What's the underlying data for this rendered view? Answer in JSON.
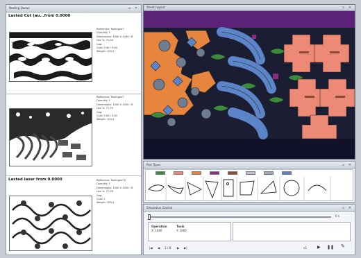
{
  "left_panel": {
    "title": "Nesting Queue",
    "sheets": [
      {
        "header": "Lasted Cut (au...from 0.0000",
        "lines": [
          "Reference: Toolingno7",
          "Quantity: 1",
          "Dimensions: 1000 X 1000 / 6",
          "Use %: 71.04",
          "Gap:",
          "Cost: 0.00 / 0.00",
          "Weight: 100.4"
        ]
      },
      {
        "header": "",
        "lines": [
          "Reference: Toolingno7",
          "Quantity: 1",
          "Dimensions: 1000 X 1000 / 6",
          "Use %: 77.79",
          "Gap:",
          "Cost: 0.00 / 0.00",
          "Weight: 100.4"
        ]
      },
      {
        "header": "Lasted laser from 0.0000",
        "lines": [
          "Reference: Toolingno70",
          "Quantity: 1",
          "Dimensions: 1000 X 1000 / 6",
          "Use %: 77.99",
          "Gap:",
          "Cost: 1",
          "Weight: 100.4"
        ]
      }
    ]
  },
  "canvas": {
    "title": "Sheet Layout",
    "background": "#11112a",
    "colors": {
      "purple": "#5b2277",
      "orange": "#e7853f",
      "blue": "#5b84c9",
      "salmon": "#ec8a76",
      "green": "#3c8b3d",
      "steel": "#6f7d92"
    }
  },
  "parts_panel": {
    "title": "Part Types",
    "swatches": [
      "#3c8b3d",
      "#ec8a76",
      "#e7853f",
      "#8a2d86",
      "#8b4a3a",
      "#b8c1ce",
      "#9aa9bd",
      "#5b84c9"
    ]
  },
  "sim_panel": {
    "title": "Simulation Control",
    "slider_value": "0 s",
    "col1_title": "Operation",
    "col2_title": "Tools",
    "row1_a": "X: 1000",
    "row1_b": "Y: 1000",
    "page_text": "1 / 8",
    "speed_label": "x1",
    "btns": [
      "|◀",
      "◀",
      "▶",
      "▶|"
    ]
  }
}
